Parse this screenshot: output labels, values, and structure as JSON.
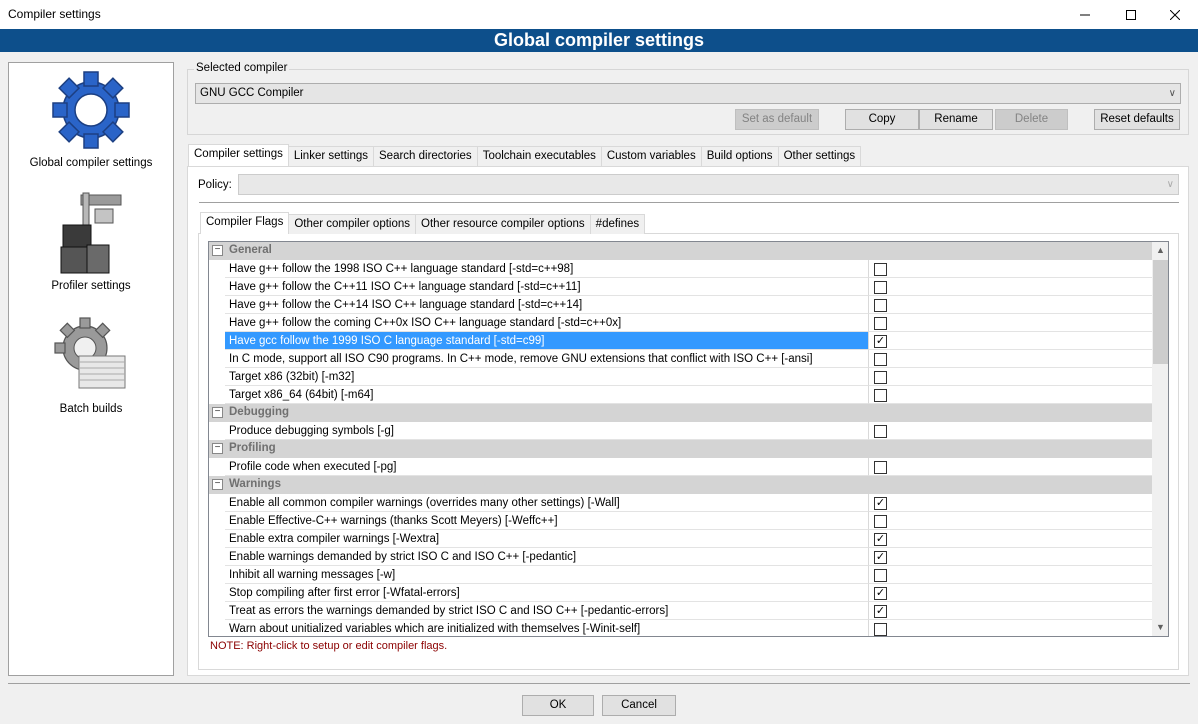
{
  "window": {
    "title": "Compiler settings",
    "banner": "Global compiler settings"
  },
  "sidebar": {
    "items": [
      {
        "label": "Global compiler settings",
        "icon": "gear-icon"
      },
      {
        "label": "Profiler settings",
        "icon": "caliper-icon"
      },
      {
        "label": "Batch builds",
        "icon": "batch-gear-icon"
      }
    ]
  },
  "compiler": {
    "group_title": "Selected compiler",
    "selected": "GNU GCC Compiler",
    "buttons": {
      "set_default": "Set as default",
      "copy": "Copy",
      "rename": "Rename",
      "delete": "Delete",
      "reset": "Reset defaults"
    }
  },
  "outer_tabs": [
    "Compiler settings",
    "Linker settings",
    "Search directories",
    "Toolchain executables",
    "Custom variables",
    "Build options",
    "Other settings"
  ],
  "policy": {
    "label": "Policy:",
    "value": ""
  },
  "inner_tabs": [
    "Compiler Flags",
    "Other compiler options",
    "Other resource compiler options",
    "#defines"
  ],
  "categories": {
    "general": "General",
    "debugging": "Debugging",
    "profiling": "Profiling",
    "warnings": "Warnings"
  },
  "flags": {
    "general": [
      {
        "label": "Have g++ follow the 1998 ISO C++ language standard  [-std=c++98]",
        "checked": false
      },
      {
        "label": "Have g++ follow the C++11 ISO C++ language standard  [-std=c++11]",
        "checked": false
      },
      {
        "label": "Have g++ follow the C++14 ISO C++ language standard  [-std=c++14]",
        "checked": false
      },
      {
        "label": "Have g++ follow the coming C++0x ISO C++ language standard  [-std=c++0x]",
        "checked": false
      },
      {
        "label": "Have gcc follow the 1999 ISO C language standard  [-std=c99]",
        "checked": true
      },
      {
        "label": "In C mode, support all ISO C90 programs. In C++ mode, remove GNU extensions that conflict with ISO C++  [-ansi]",
        "checked": false
      },
      {
        "label": "Target x86 (32bit)  [-m32]",
        "checked": false
      },
      {
        "label": "Target x86_64 (64bit)  [-m64]",
        "checked": false
      }
    ],
    "debugging": [
      {
        "label": "Produce debugging symbols  [-g]",
        "checked": false
      }
    ],
    "profiling": [
      {
        "label": "Profile code when executed  [-pg]",
        "checked": false
      }
    ],
    "warnings": [
      {
        "label": "Enable all common compiler warnings (overrides many other settings)  [-Wall]",
        "checked": true
      },
      {
        "label": "Enable Effective-C++ warnings (thanks Scott Meyers)  [-Weffc++]",
        "checked": false
      },
      {
        "label": "Enable extra compiler warnings  [-Wextra]",
        "checked": true
      },
      {
        "label": "Enable warnings demanded by strict ISO C and ISO C++  [-pedantic]",
        "checked": true
      },
      {
        "label": "Inhibit all warning messages  [-w]",
        "checked": false
      },
      {
        "label": "Stop compiling after first error  [-Wfatal-errors]",
        "checked": true
      },
      {
        "label": "Treat as errors the warnings demanded by strict ISO C and ISO C++  [-pedantic-errors]",
        "checked": true
      },
      {
        "label": "Warn about unitialized variables which are initialized with themselves  [-Winit-self]",
        "checked": false
      }
    ]
  },
  "note": "NOTE: Right-click to setup or edit compiler flags.",
  "footer": {
    "ok": "OK",
    "cancel": "Cancel"
  },
  "colors": {
    "banner": "#0d4f8b",
    "selection": "#3399ff",
    "category_bg": "#d4d4d4",
    "note": "#8b0000"
  }
}
